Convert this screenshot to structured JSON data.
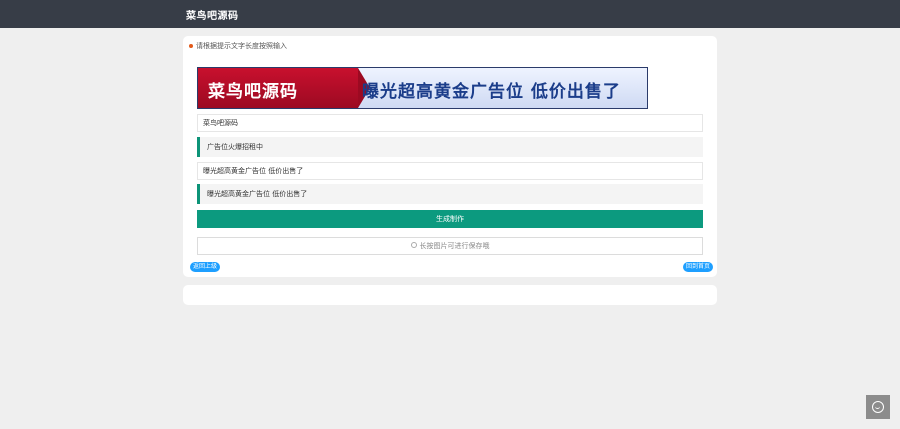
{
  "header": {
    "title": "菜鸟吧源码"
  },
  "form": {
    "hint": "请根据提示文字长度按照输入",
    "banner": {
      "left_text": "菜鸟吧源码",
      "right_text": "曝光超高黄金广告位 低价出售了"
    },
    "field1_value": "菜鸟吧源码",
    "quote1": "广告位火爆招租中",
    "field2_value": "曝光超高黄金广告位 低价出售了",
    "quote2": "曝光超高黄金广告位 低价出售了",
    "generate_label": "生成制作",
    "save_label": "长按图片可进行保存哦"
  },
  "nav": {
    "back_label": "返回上级",
    "home_label": "回到首页"
  },
  "colors": {
    "accent": "#0c9a7f",
    "header_bg": "#373d47",
    "pill": "#1e9fff",
    "banner_red": "#c8102e",
    "banner_blue": "#1b3d8a"
  }
}
